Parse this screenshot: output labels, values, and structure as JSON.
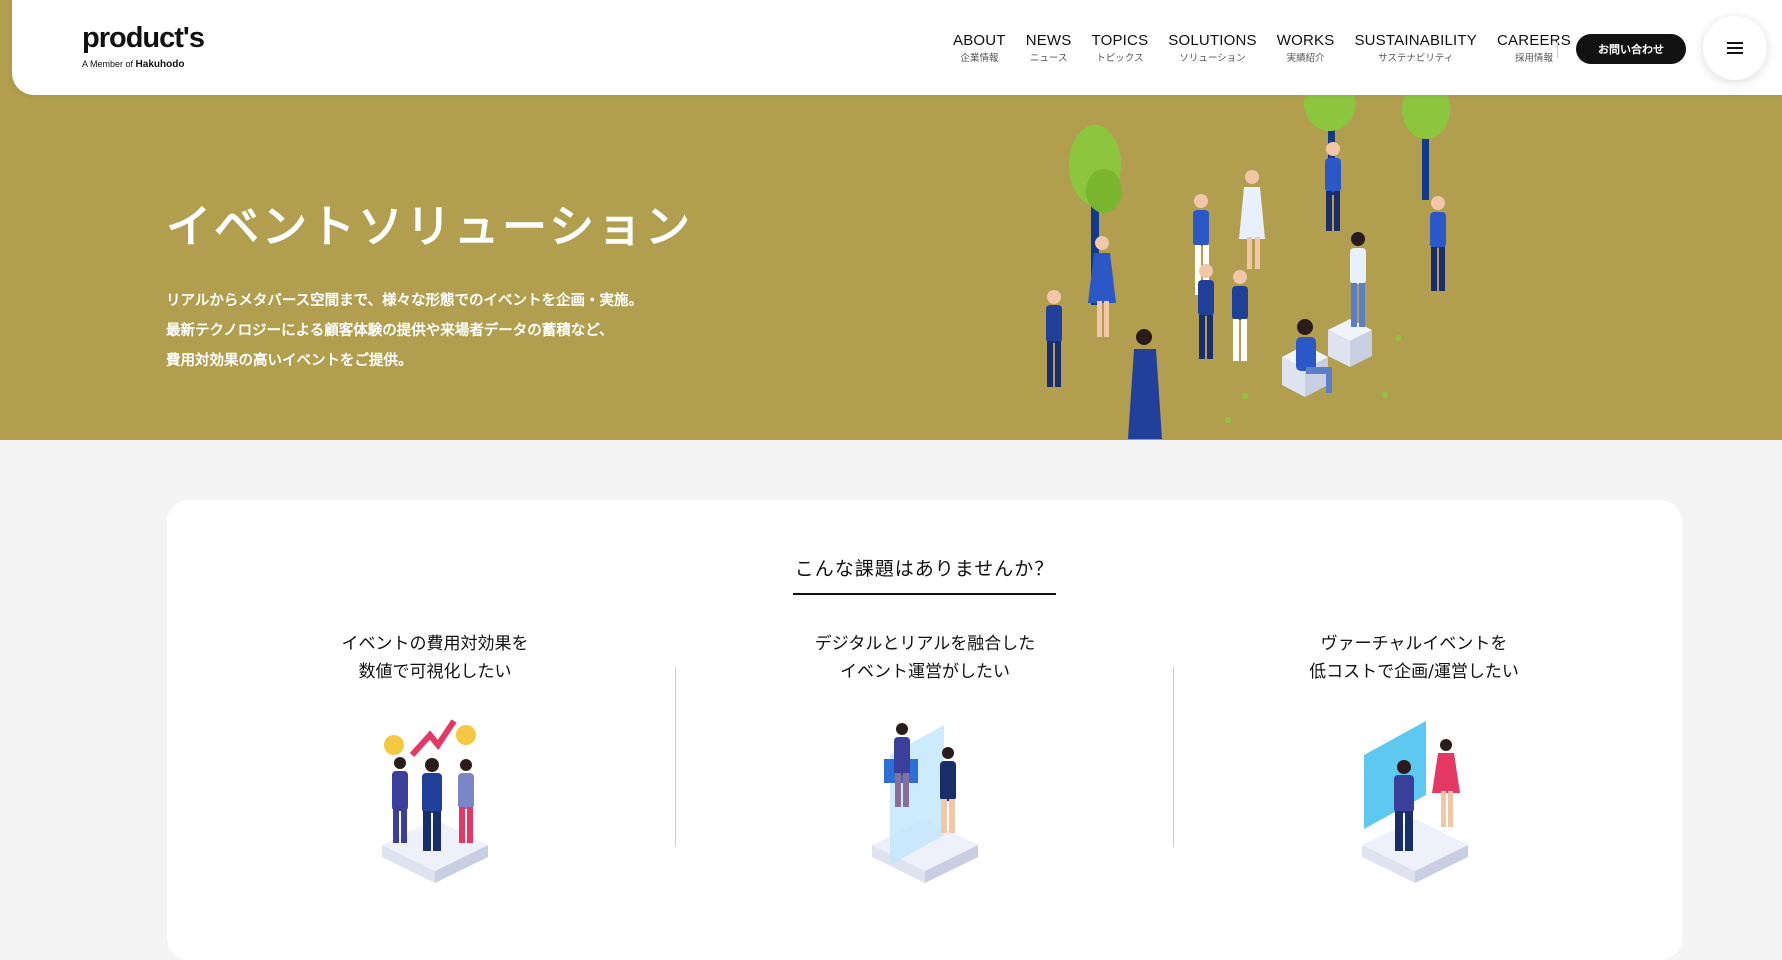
{
  "header": {
    "logo": {
      "main": "product's",
      "sub_prefix": "A Member of",
      "sub_brand": "Hakuhodo"
    },
    "nav": [
      {
        "en": "ABOUT",
        "ja": "企業情報"
      },
      {
        "en": "NEWS",
        "ja": "ニュース"
      },
      {
        "en": "TOPICS",
        "ja": "トピックス"
      },
      {
        "en": "SOLUTIONS",
        "ja": "ソリューション"
      },
      {
        "en": "WORKS",
        "ja": "実績紹介"
      },
      {
        "en": "SUSTAINABILITY",
        "ja": "サステナビリティ"
      },
      {
        "en": "CAREERS",
        "ja": "採用情報"
      }
    ],
    "contact_label": "お問い合わせ",
    "menu_icon": "hamburger-icon"
  },
  "hero": {
    "title": "イベントソリューション",
    "description": [
      "リアルからメタバース空間まで、様々な形態でのイベントを企画・実施。",
      "最新テクノロジーによる顧客体験の提供や来場者データの蓄積など、",
      "費用対効果の高いイベントをご提供。"
    ],
    "background_color": "#b19f4f"
  },
  "issues": {
    "heading": "こんな課題はありませんか？",
    "items": [
      {
        "lines": [
          "イベントの費用対効果を",
          "数値で可視化したい"
        ]
      },
      {
        "lines": [
          "デジタルとリアルを融合した",
          "イベント運営がしたい"
        ]
      },
      {
        "lines": [
          "ヴァーチャルイベントを",
          "低コストで企画/運営したい"
        ]
      }
    ]
  }
}
